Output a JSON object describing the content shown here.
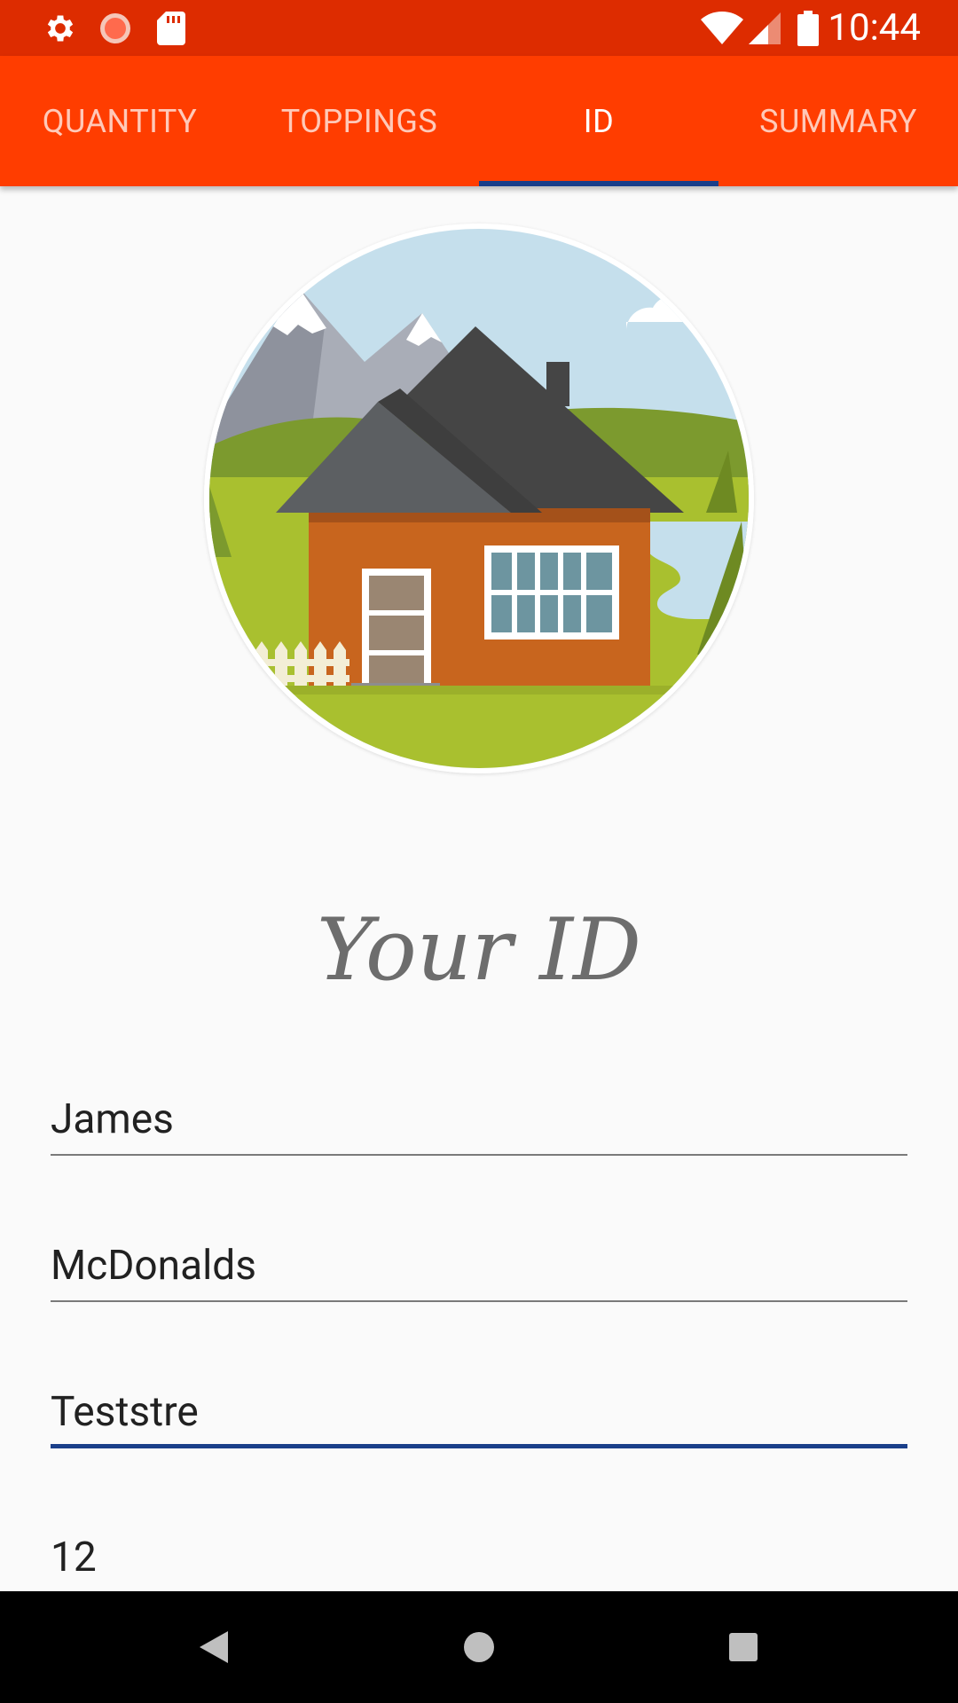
{
  "status_bar": {
    "time": "10:44",
    "icons_left": [
      "settings-icon",
      "recording-icon",
      "sd-card-icon"
    ],
    "icons_right": [
      "wifi-icon",
      "cell-signal-icon",
      "battery-icon"
    ]
  },
  "tabs": [
    {
      "label": "QUANTITY",
      "active": false
    },
    {
      "label": "TOPPINGS",
      "active": false
    },
    {
      "label": "ID",
      "active": true
    },
    {
      "label": "SUMMARY",
      "active": false
    }
  ],
  "main": {
    "heading": "Your ID",
    "fields": [
      {
        "value": "James",
        "focused": false
      },
      {
        "value": "McDonalds",
        "focused": false
      },
      {
        "value": "Teststre",
        "focused": true
      },
      {
        "value": "12",
        "focused": false
      }
    ]
  },
  "nav_bar": {
    "buttons": [
      "back-icon",
      "home-icon",
      "recents-icon"
    ]
  },
  "colors": {
    "status_bar": "#dd2c00",
    "app_bar": "#ff3d00",
    "indicator": "#1a3f8a",
    "background": "#fafafa"
  }
}
